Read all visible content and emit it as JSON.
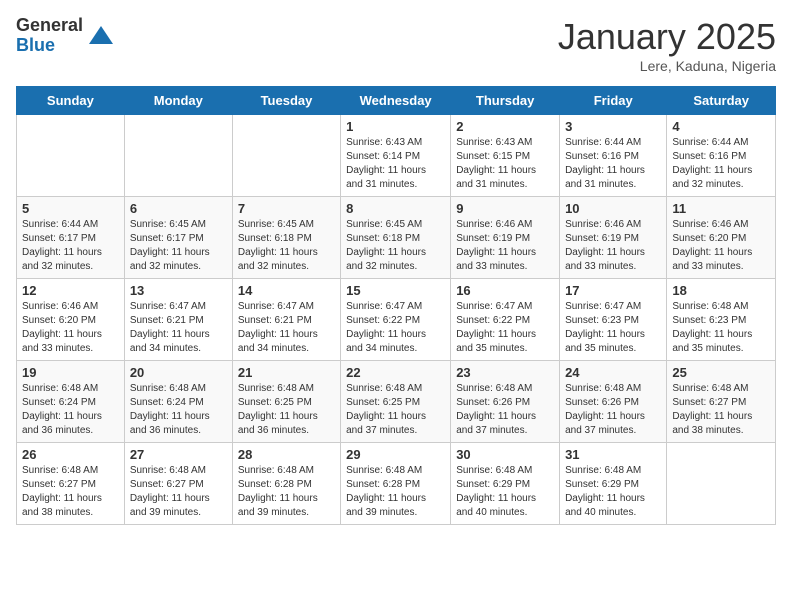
{
  "header": {
    "logo_general": "General",
    "logo_blue": "Blue",
    "month_title": "January 2025",
    "subtitle": "Lere, Kaduna, Nigeria"
  },
  "days_of_week": [
    "Sunday",
    "Monday",
    "Tuesday",
    "Wednesday",
    "Thursday",
    "Friday",
    "Saturday"
  ],
  "weeks": [
    [
      {
        "day": "",
        "info": ""
      },
      {
        "day": "",
        "info": ""
      },
      {
        "day": "",
        "info": ""
      },
      {
        "day": "1",
        "info": "Sunrise: 6:43 AM\nSunset: 6:14 PM\nDaylight: 11 hours and 31 minutes."
      },
      {
        "day": "2",
        "info": "Sunrise: 6:43 AM\nSunset: 6:15 PM\nDaylight: 11 hours and 31 minutes."
      },
      {
        "day": "3",
        "info": "Sunrise: 6:44 AM\nSunset: 6:16 PM\nDaylight: 11 hours and 31 minutes."
      },
      {
        "day": "4",
        "info": "Sunrise: 6:44 AM\nSunset: 6:16 PM\nDaylight: 11 hours and 32 minutes."
      }
    ],
    [
      {
        "day": "5",
        "info": "Sunrise: 6:44 AM\nSunset: 6:17 PM\nDaylight: 11 hours and 32 minutes."
      },
      {
        "day": "6",
        "info": "Sunrise: 6:45 AM\nSunset: 6:17 PM\nDaylight: 11 hours and 32 minutes."
      },
      {
        "day": "7",
        "info": "Sunrise: 6:45 AM\nSunset: 6:18 PM\nDaylight: 11 hours and 32 minutes."
      },
      {
        "day": "8",
        "info": "Sunrise: 6:45 AM\nSunset: 6:18 PM\nDaylight: 11 hours and 32 minutes."
      },
      {
        "day": "9",
        "info": "Sunrise: 6:46 AM\nSunset: 6:19 PM\nDaylight: 11 hours and 33 minutes."
      },
      {
        "day": "10",
        "info": "Sunrise: 6:46 AM\nSunset: 6:19 PM\nDaylight: 11 hours and 33 minutes."
      },
      {
        "day": "11",
        "info": "Sunrise: 6:46 AM\nSunset: 6:20 PM\nDaylight: 11 hours and 33 minutes."
      }
    ],
    [
      {
        "day": "12",
        "info": "Sunrise: 6:46 AM\nSunset: 6:20 PM\nDaylight: 11 hours and 33 minutes."
      },
      {
        "day": "13",
        "info": "Sunrise: 6:47 AM\nSunset: 6:21 PM\nDaylight: 11 hours and 34 minutes."
      },
      {
        "day": "14",
        "info": "Sunrise: 6:47 AM\nSunset: 6:21 PM\nDaylight: 11 hours and 34 minutes."
      },
      {
        "day": "15",
        "info": "Sunrise: 6:47 AM\nSunset: 6:22 PM\nDaylight: 11 hours and 34 minutes."
      },
      {
        "day": "16",
        "info": "Sunrise: 6:47 AM\nSunset: 6:22 PM\nDaylight: 11 hours and 35 minutes."
      },
      {
        "day": "17",
        "info": "Sunrise: 6:47 AM\nSunset: 6:23 PM\nDaylight: 11 hours and 35 minutes."
      },
      {
        "day": "18",
        "info": "Sunrise: 6:48 AM\nSunset: 6:23 PM\nDaylight: 11 hours and 35 minutes."
      }
    ],
    [
      {
        "day": "19",
        "info": "Sunrise: 6:48 AM\nSunset: 6:24 PM\nDaylight: 11 hours and 36 minutes."
      },
      {
        "day": "20",
        "info": "Sunrise: 6:48 AM\nSunset: 6:24 PM\nDaylight: 11 hours and 36 minutes."
      },
      {
        "day": "21",
        "info": "Sunrise: 6:48 AM\nSunset: 6:25 PM\nDaylight: 11 hours and 36 minutes."
      },
      {
        "day": "22",
        "info": "Sunrise: 6:48 AM\nSunset: 6:25 PM\nDaylight: 11 hours and 37 minutes."
      },
      {
        "day": "23",
        "info": "Sunrise: 6:48 AM\nSunset: 6:26 PM\nDaylight: 11 hours and 37 minutes."
      },
      {
        "day": "24",
        "info": "Sunrise: 6:48 AM\nSunset: 6:26 PM\nDaylight: 11 hours and 37 minutes."
      },
      {
        "day": "25",
        "info": "Sunrise: 6:48 AM\nSunset: 6:27 PM\nDaylight: 11 hours and 38 minutes."
      }
    ],
    [
      {
        "day": "26",
        "info": "Sunrise: 6:48 AM\nSunset: 6:27 PM\nDaylight: 11 hours and 38 minutes."
      },
      {
        "day": "27",
        "info": "Sunrise: 6:48 AM\nSunset: 6:27 PM\nDaylight: 11 hours and 39 minutes."
      },
      {
        "day": "28",
        "info": "Sunrise: 6:48 AM\nSunset: 6:28 PM\nDaylight: 11 hours and 39 minutes."
      },
      {
        "day": "29",
        "info": "Sunrise: 6:48 AM\nSunset: 6:28 PM\nDaylight: 11 hours and 39 minutes."
      },
      {
        "day": "30",
        "info": "Sunrise: 6:48 AM\nSunset: 6:29 PM\nDaylight: 11 hours and 40 minutes."
      },
      {
        "day": "31",
        "info": "Sunrise: 6:48 AM\nSunset: 6:29 PM\nDaylight: 11 hours and 40 minutes."
      },
      {
        "day": "",
        "info": ""
      }
    ]
  ]
}
